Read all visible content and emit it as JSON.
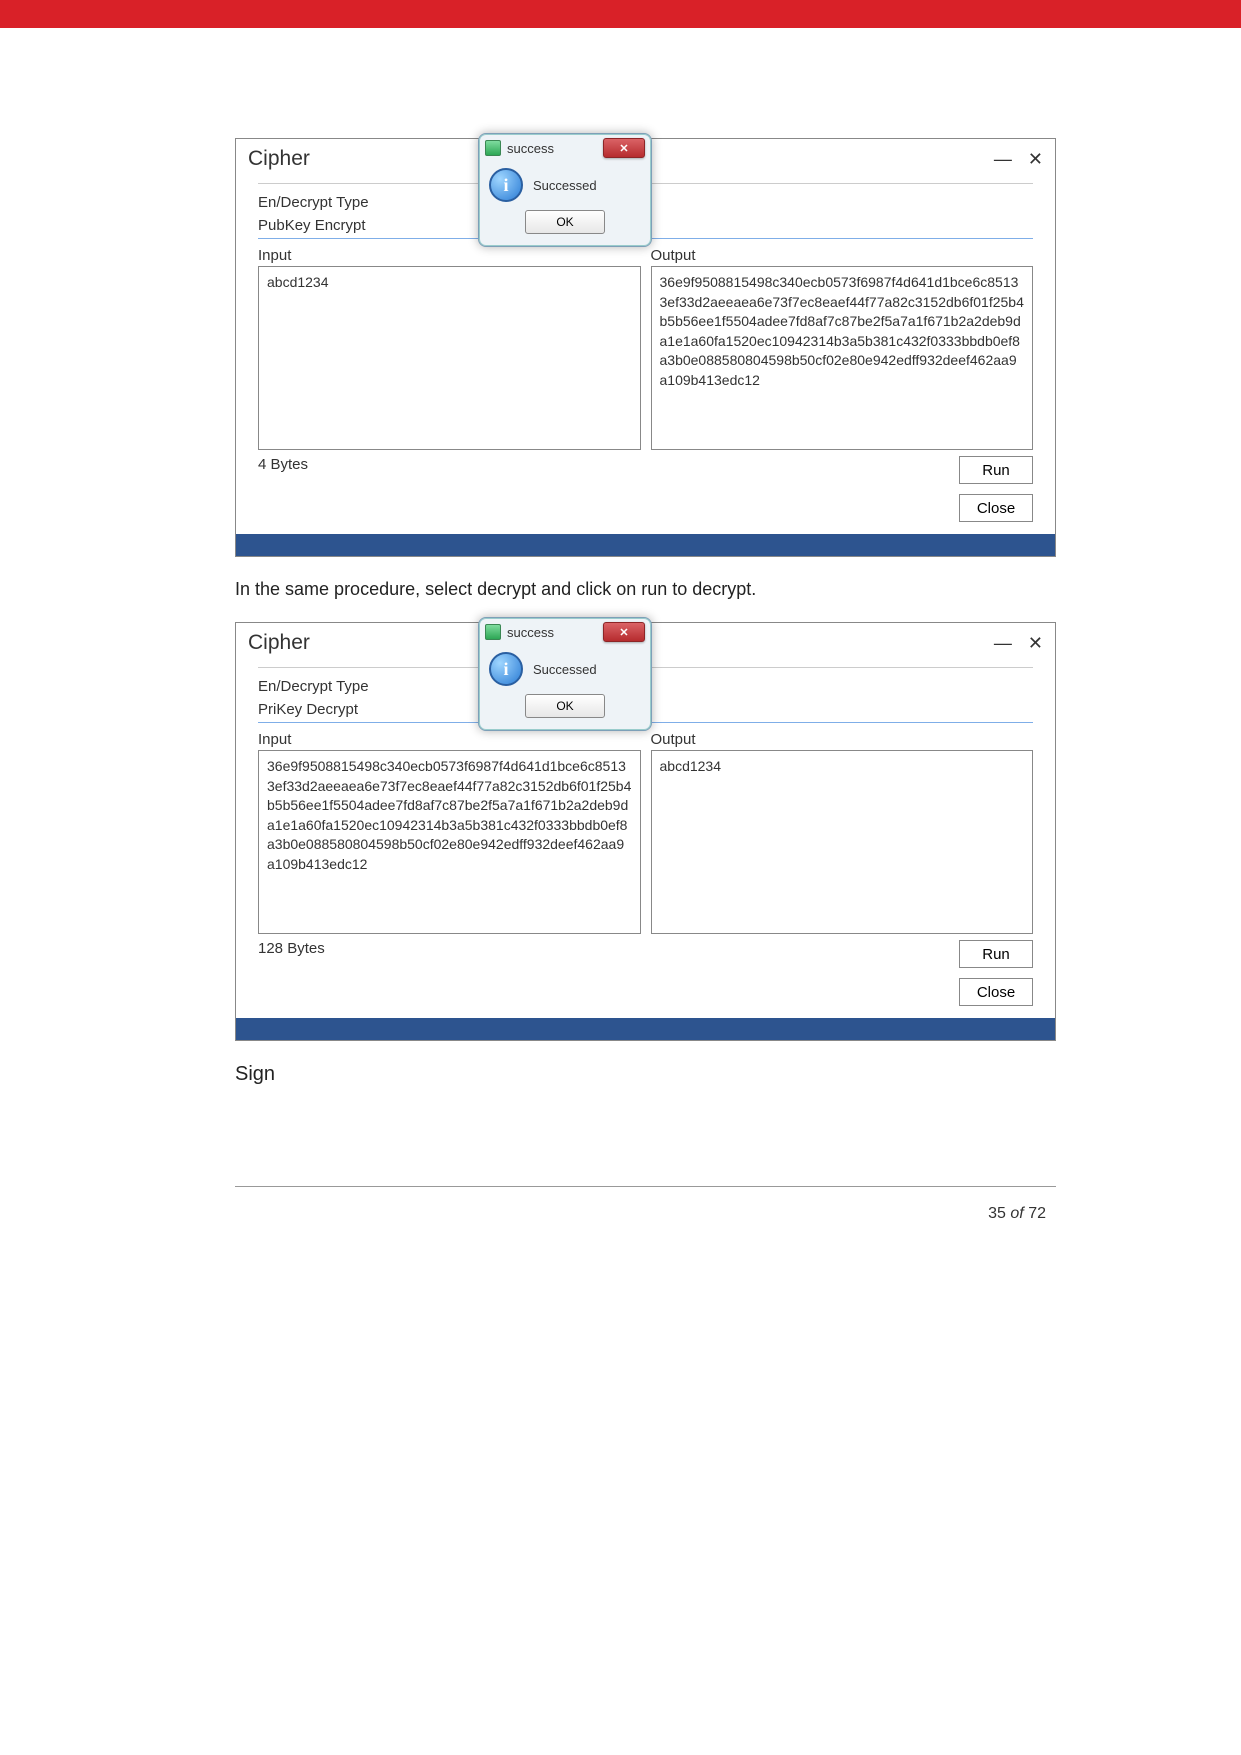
{
  "shot1": {
    "title": "Cipher",
    "type_label": "En/Decrypt Type",
    "type_value": "PubKey Encrypt",
    "input_label": "Input",
    "output_label": "Output",
    "input_value": "abcd1234",
    "output_value": "36e9f9508815498c340ecb0573f6987f4d641d1bce6c85133ef33d2aeeaea6e73f7ec8eaef44f77a82c3152db6f01f25b4b5b56ee1f5504adee7fd8af7c87be2f5a7a1f671b2a2deb9da1e1a60fa1520ec10942314b3a5b381c432f0333bbdb0ef8a3b0e088580804598b50cf02e80e942edff932deef462aa9a109b413edc12",
    "bytes": "4 Bytes",
    "run": "Run",
    "close": "Close",
    "dlg_title": "success",
    "dlg_msg": "Successed",
    "dlg_ok": "OK"
  },
  "caption1": "In the same procedure, select decrypt and click on run to decrypt.",
  "shot2": {
    "title": "Cipher",
    "type_label": "En/Decrypt Type",
    "type_value": "PriKey Decrypt",
    "input_label": "Input",
    "output_label": "Output",
    "input_value": "36e9f9508815498c340ecb0573f6987f4d641d1bce6c85133ef33d2aeeaea6e73f7ec8eaef44f77a82c3152db6f01f25b4b5b56ee1f5504adee7fd8af7c87be2f5a7a1f671b2a2deb9da1e1a60fa1520ec10942314b3a5b381c432f0333bbdb0ef8a3b0e088580804598b50cf02e80e942edff932deef462aa9a109b413edc12",
    "output_value": "abcd1234",
    "bytes": "128 Bytes",
    "run": "Run",
    "close": "Close",
    "dlg_title": "success",
    "dlg_msg": "Successed",
    "dlg_ok": "OK"
  },
  "heading2": "Sign",
  "page_num": "35",
  "page_of": "of ",
  "page_total": "72"
}
